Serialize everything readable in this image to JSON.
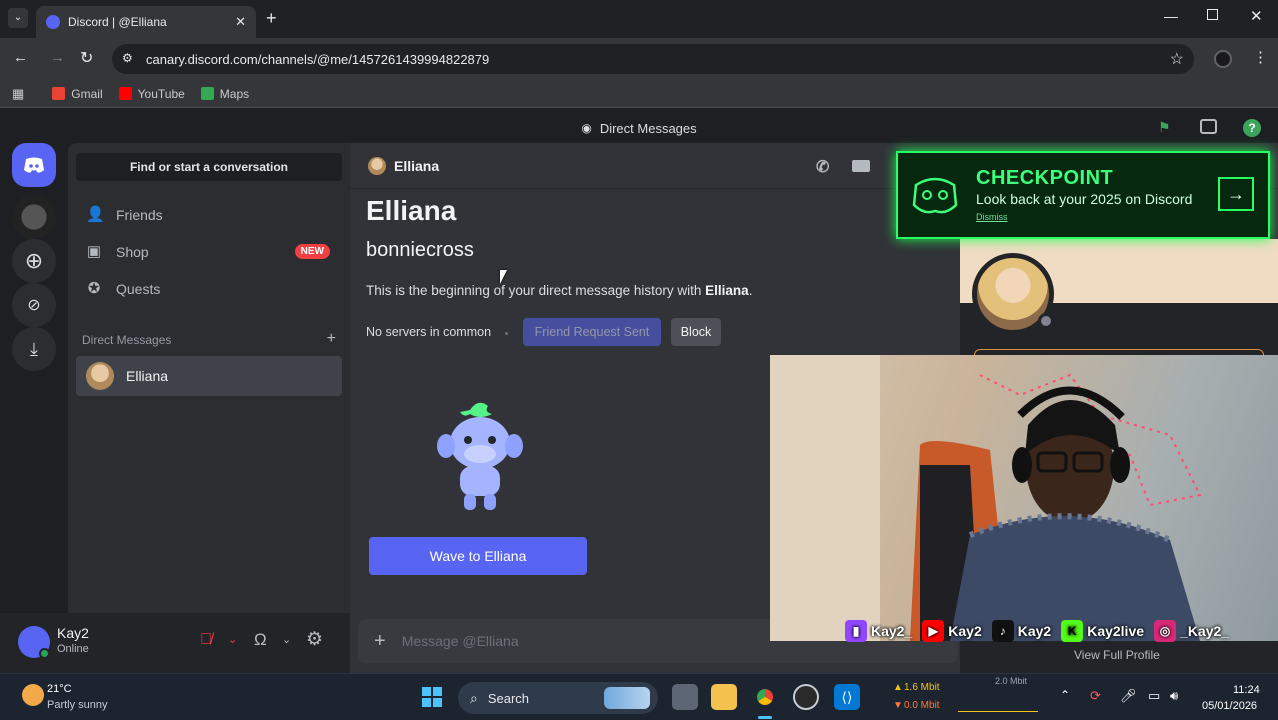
{
  "browser": {
    "tab_title": "Discord | @Elliana",
    "url": "canary.discord.com/channels/@me/1457261439994822879",
    "bookmarks": [
      {
        "label": "Gmail",
        "color": "#ea4335"
      },
      {
        "label": "YouTube",
        "color": "#ff0000"
      },
      {
        "label": "Maps",
        "color": "#34a853"
      }
    ]
  },
  "titlestrip": {
    "label": "Direct Messages"
  },
  "sidebar": {
    "search_label": "Find or start a conversation",
    "nav": [
      {
        "label": "Friends",
        "icon": "friends-icon"
      },
      {
        "label": "Shop",
        "icon": "shop-icon",
        "badge": "NEW"
      },
      {
        "label": "Quests",
        "icon": "quests-icon"
      }
    ],
    "dm_header": "Direct Messages",
    "dm_add": "+",
    "dm_items": [
      {
        "name": "Elliana"
      }
    ]
  },
  "user_panel": {
    "name": "Kay2",
    "status": "Online"
  },
  "channel": {
    "header_name": "Elliana",
    "display_name": "Elliana",
    "username": "bonniecross",
    "beginning_prefix": "This is the beginning of your direct message history with ",
    "beginning_name": "Elliana",
    "beginning_suffix": ".",
    "no_servers": "No servers in common",
    "friend_request_label": "Friend Request Sent",
    "block_label": "Block",
    "wave_label": "Wave to Elliana",
    "message_placeholder": "Message @Elliana"
  },
  "checkpoint": {
    "title": "CHECKPOINT",
    "subtitle": "Look back at your 2025 on Discord",
    "dismiss": "Dismiss"
  },
  "profile": {
    "view_full": "View Full Profile"
  },
  "overlay": {
    "socials": [
      {
        "handle": "Kay2_",
        "color": "#9146ff",
        "icon": "twitch-icon"
      },
      {
        "handle": "Kay2",
        "color": "#ff0000",
        "icon": "youtube-icon"
      },
      {
        "handle": "Kay2",
        "color": "#111111",
        "icon": "tiktok-icon"
      },
      {
        "handle": "Kay2live",
        "color": "#53fc18",
        "icon": "kick-icon"
      },
      {
        "handle": "_Kay2_",
        "color": "#d62976",
        "icon": "instagram-icon"
      }
    ]
  },
  "taskbar": {
    "weather_temp": "21°C",
    "weather_desc": "Partly sunny",
    "search_label": "Search",
    "net_up": "1.6 Mbit",
    "net_down": "0.0 Mbit",
    "net_scale": "2.0 Mbit",
    "time": "11:24",
    "date": "05/01/2026"
  },
  "colors": {
    "blurple": "#5865f2",
    "checkpoint_green": "#27ff63",
    "new_badge": "#f23f43"
  }
}
